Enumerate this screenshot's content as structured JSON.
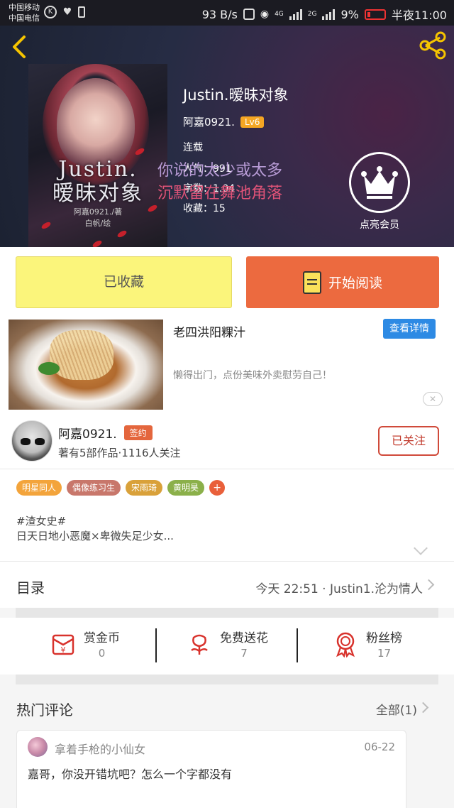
{
  "status_bar": {
    "carrier_1": "中国移动",
    "carrier_2": "中国电信",
    "network_speed": "93 B/s",
    "net_4g": "4G",
    "net_2g": "2G",
    "battery": "9%",
    "time": "半夜11:00",
    "battery_color": "#e33333"
  },
  "book": {
    "title": "Justin.暧昧对象",
    "author": "阿嘉0921.",
    "author_level": "Lv6",
    "status": "连载",
    "views": "人气：991",
    "words": "字数：1.04",
    "favorites": "收藏：15",
    "cover_title": "Justin.\n暧昧对象",
    "cover_author": "阿嘉0921./著\n白帆/绘"
  },
  "overlay_lyrics": {
    "line1": "你说的太少或太多",
    "line2": "沉默留在舞池角落"
  },
  "vip": {
    "label": "点亮会员"
  },
  "actions": {
    "collected_label": "已收藏",
    "read_label": "开始阅读"
  },
  "ad": {
    "title": "老四洪阳粿汁",
    "detail_label": "查看详情",
    "description": "懒得出门，点份美味外卖慰劳自己！",
    "close_icon": "✕"
  },
  "author_info": {
    "name": "阿嘉0921.",
    "badge": "签约",
    "stats": "著有5部作品·1116人关注",
    "follow_label": "已关注"
  },
  "tags": [
    {
      "label": "明星同人",
      "color": "#f3a43b"
    },
    {
      "label": "偶像练习生",
      "color": "#c8776b"
    },
    {
      "label": "宋雨琦",
      "color": "#d9a13a"
    },
    {
      "label": "黄明昊",
      "color": "#8bb04a"
    }
  ],
  "tag_add": "+",
  "intro": {
    "line1": "#渣女史#",
    "line2": "日天日地小恶魔×卑微失足少女..."
  },
  "toc": {
    "label": "目录",
    "latest": "今天 22:51 · Justin1.沦为情人"
  },
  "stats": [
    {
      "label": "赏金币",
      "value": "0",
      "icon": "red-envelope-icon"
    },
    {
      "label": "免费送花",
      "value": "7",
      "icon": "flower-icon"
    },
    {
      "label": "粉丝榜",
      "value": "17",
      "icon": "medal-icon"
    }
  ],
  "comments": {
    "title": "热门评论",
    "all_label": "全部(1)",
    "items": [
      {
        "user": "拿着手枪的小仙女",
        "date": "06-22",
        "text": "嘉哥，你没开错坑吧？怎么一个字都没有"
      }
    ]
  },
  "colors": {
    "accent_orange": "#ec6a3f",
    "collected_yellow": "#fbf57b",
    "link_blue": "#2d8ae4",
    "follow_red": "#d04a3a"
  }
}
